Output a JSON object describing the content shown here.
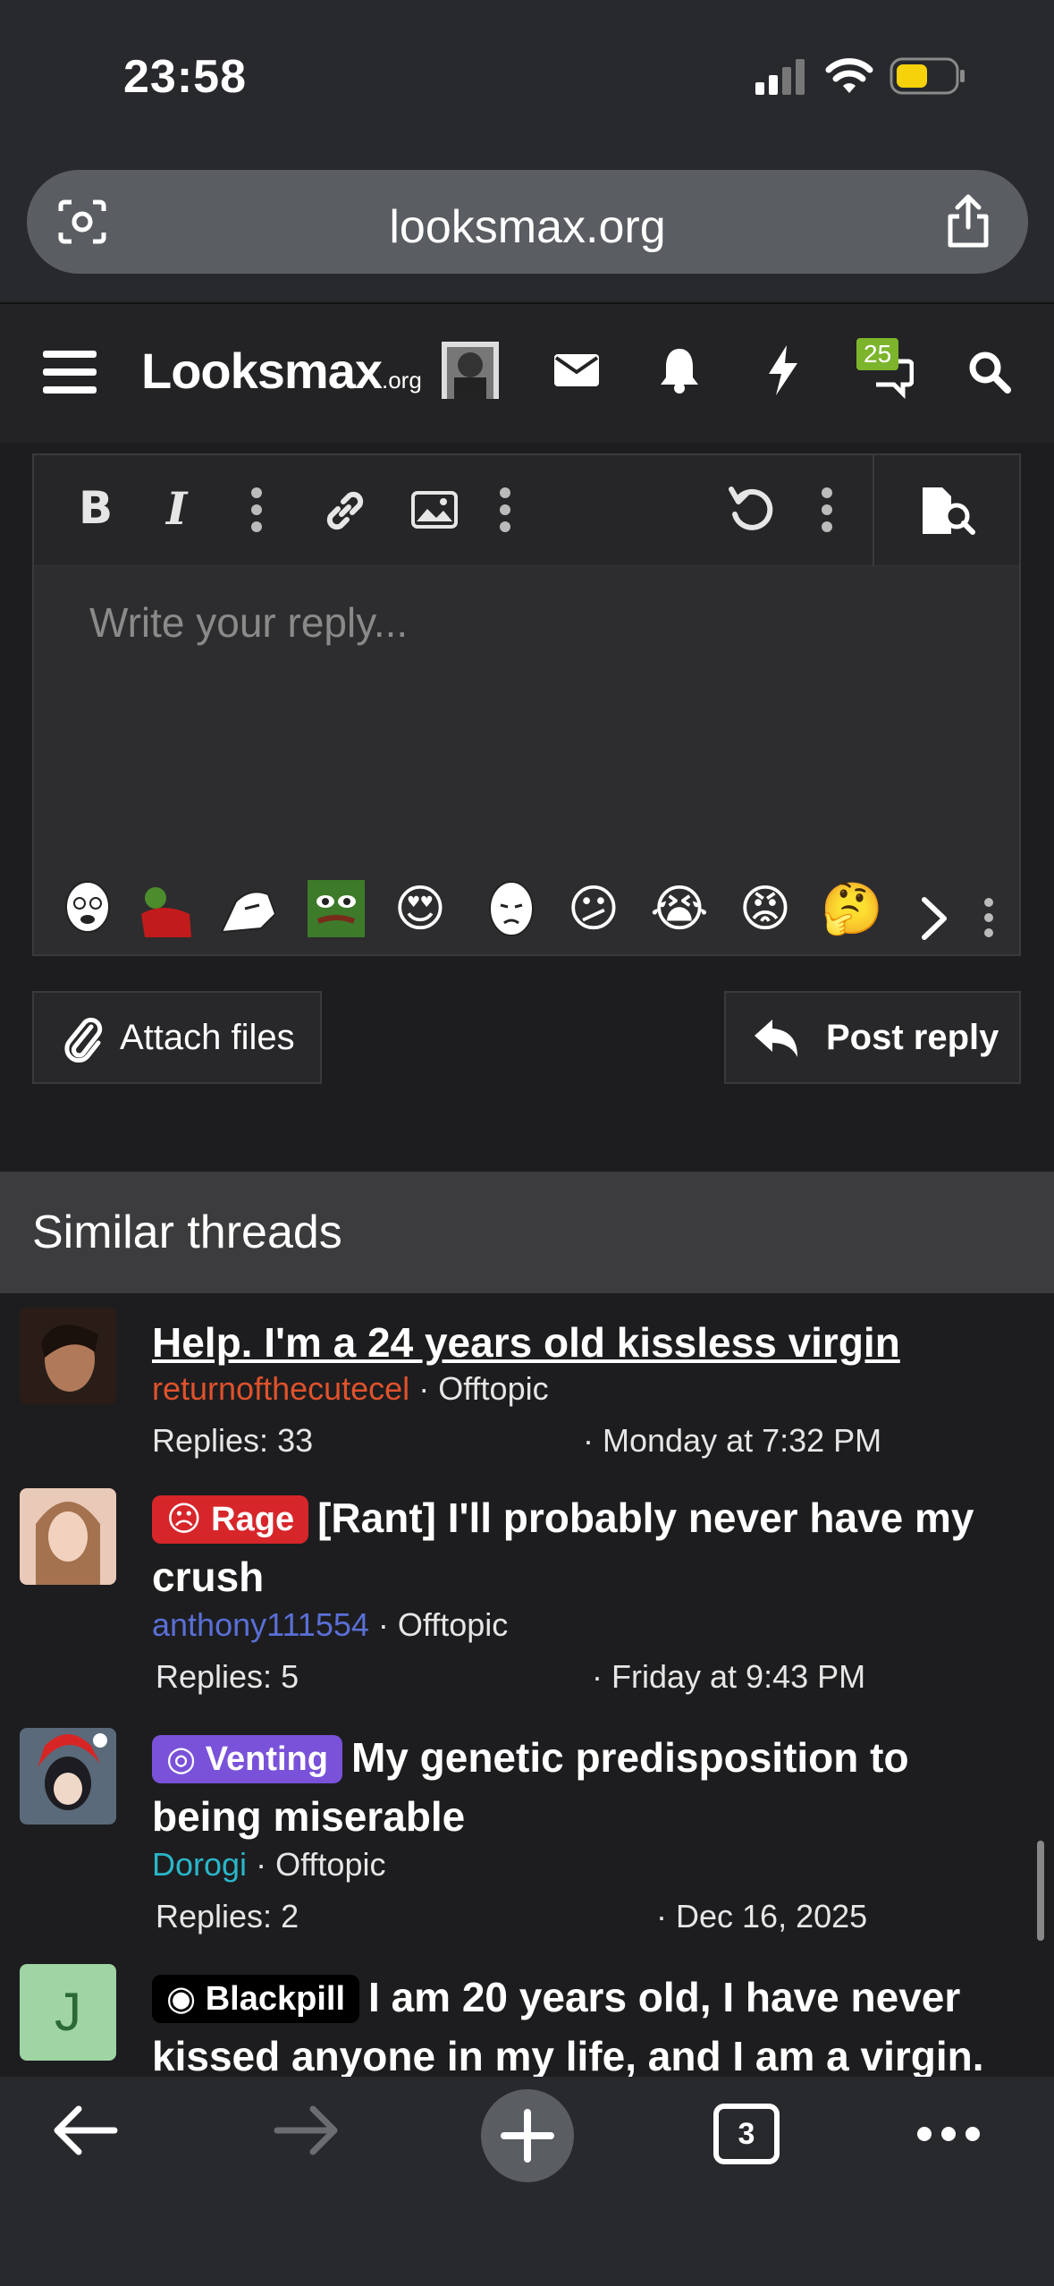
{
  "status": {
    "time": "23:58"
  },
  "browser": {
    "url": "looksmax.org",
    "tabs_count": "3"
  },
  "site": {
    "logo_main": "Looksmax",
    "logo_tld": ".org",
    "notifications_badge": "25"
  },
  "editor": {
    "placeholder": "Write your reply...",
    "emojis": [
      "soyjak",
      "pepe-red",
      "gigachad",
      "pepe",
      "😍",
      "wojak-cry",
      "😕",
      "😭",
      "😡",
      "🤔"
    ]
  },
  "actions": {
    "attach_label": "Attach files",
    "post_label": "Post reply"
  },
  "similar": {
    "title": "Similar threads",
    "threads": [
      {
        "title": "Help. I'm a 24 years old kissless virgin",
        "author": "returnofthecutecel",
        "forum": "Offtopic",
        "replies": "Replies: 33",
        "date": "Monday at 7:32 PM",
        "author_color": "#e0522c"
      },
      {
        "prefix": "Rage",
        "title": "[Rant] I'll probably never have my crush",
        "author": "anthony111554",
        "forum": "Offtopic",
        "replies": "Replies: 5",
        "date": "Friday at 9:43 PM",
        "author_color": "#5a6fd6"
      },
      {
        "prefix": "Venting",
        "title": "My genetic predisposition to being miserable",
        "author": "Dorogi",
        "forum": "Offtopic",
        "replies": "Replies: 2",
        "date": "Dec 16, 2025",
        "author_color": "#2ab6c9"
      },
      {
        "prefix": "Blackpill",
        "title": "I am 20 years old, I have never kissed anyone in my life, and I am a virgin.",
        "avatar_letter": "J"
      }
    ]
  }
}
